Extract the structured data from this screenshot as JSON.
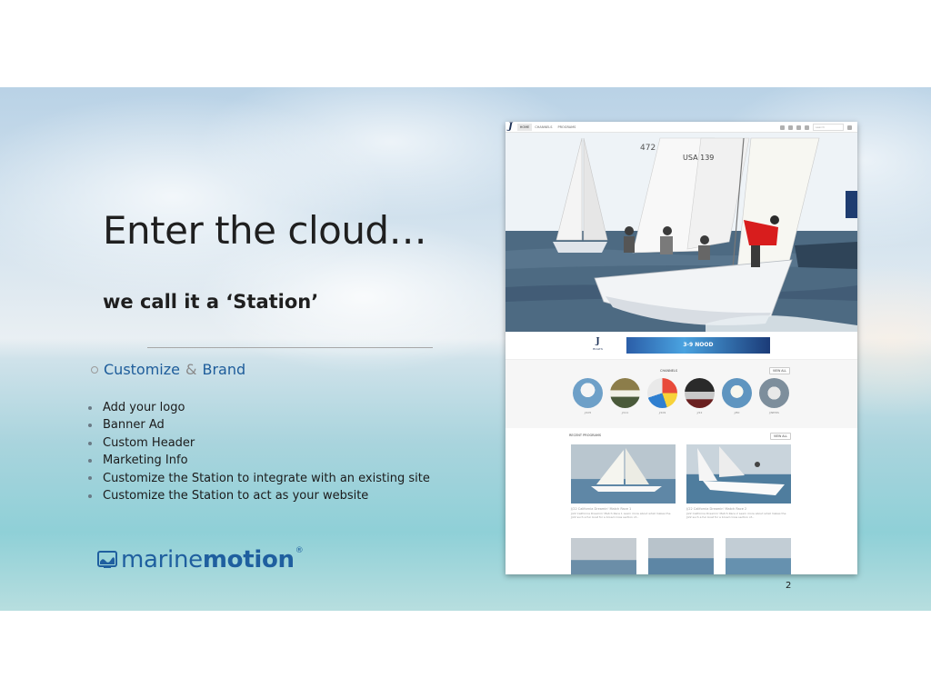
{
  "slide": {
    "title": "Enter the cloud…",
    "subtitle": "we call it a ‘Station’",
    "section_heading": {
      "part1": "Customize",
      "amp": "&",
      "part2": "Brand"
    },
    "bullets": [
      "Add your logo",
      "Banner Ad",
      "Custom Header",
      "Marketing Info",
      "Customize the Station to integrate with an existing site",
      "Customize the Station to act as your website"
    ],
    "logo": {
      "regular": "marine",
      "bold": "motion",
      "reg_mark": "®"
    },
    "page_number": "2",
    "colors": {
      "brand_blue": "#1f5f9f",
      "heading_blue": "#1d5c9a",
      "text": "#1f1f1f"
    }
  },
  "website": {
    "nav": {
      "logo": "J",
      "items": [
        "HOME",
        "CHANNELS",
        "PROGRAMS"
      ],
      "search_placeholder": "search"
    },
    "banner": {
      "logo": "J",
      "logo_sub": "BOATS",
      "ad_text": "3-9  NOOD"
    },
    "channels": {
      "label": "CHANNELS",
      "view_all": "VIEW ALL",
      "items": [
        "J/105",
        "J/111",
        "J/109",
        "J/22",
        "J/80",
        "J/NEWS"
      ]
    },
    "programs": {
      "label": "RECENT PROGRAMS",
      "view_all": "VIEW ALL",
      "cards": [
        {
          "title": "J/22 California Dreamin' Match Race 1",
          "desc": "J/22 California Dreamin' Match Race 1 Learn more about what makes the J/22 such a fun boat for a broad cross section of..."
        },
        {
          "title": "J/22 California Dreamin' Match Race 2",
          "desc": "J/22 California Dreamin' Match Race 2 Learn more about what makes the J/22 such a fun boat for a broad cross section of..."
        }
      ]
    },
    "hero": {
      "sail_numbers": [
        "472",
        "USA 139"
      ]
    }
  }
}
